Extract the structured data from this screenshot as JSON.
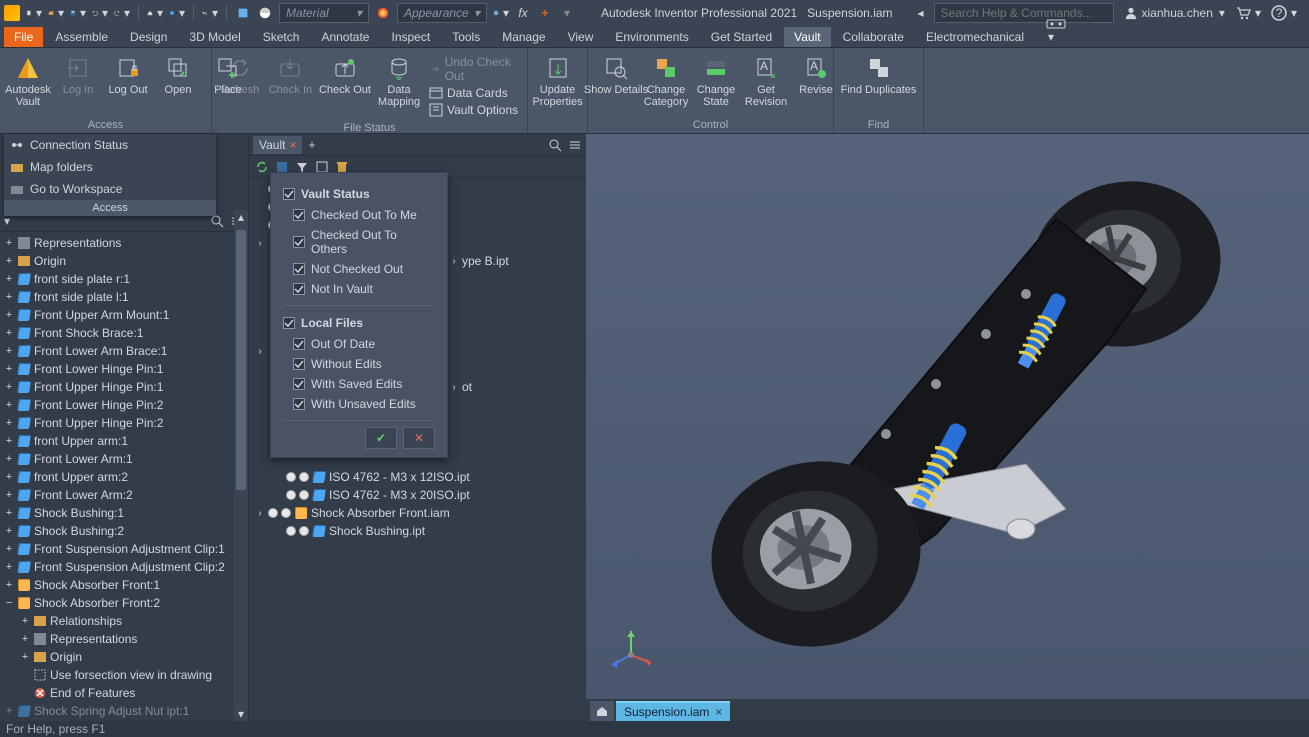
{
  "titlebar": {
    "material_placeholder": "Material",
    "appearance_placeholder": "Appearance",
    "app_title": "Autodesk Inventor Professional 2021",
    "document_name": "Suspension.iam",
    "search_placeholder": "Search Help & Commands...",
    "user_name": "xianhua.chen"
  },
  "ribbon_tabs": [
    "File",
    "Assemble",
    "Design",
    "3D Model",
    "Sketch",
    "Annotate",
    "Inspect",
    "Tools",
    "Manage",
    "View",
    "Environments",
    "Get Started",
    "Vault",
    "Collaborate",
    "Electromechanical"
  ],
  "ribbon_active": "Vault",
  "ribbon": {
    "access": {
      "autodesk_vault": "Autodesk\nVault",
      "log_in": "Log In",
      "log_out": "Log Out",
      "open": "Open",
      "place": "Place",
      "refresh": "Refresh",
      "label": "Access"
    },
    "file_status": {
      "check_in": "Check In",
      "check_out": "Check Out",
      "data_mapping": "Data\nMapping",
      "undo_check_out": "Undo Check Out",
      "data_cards": "Data Cards",
      "vault_options": "Vault Options",
      "update": "Update\nProperties",
      "label": "File Status"
    },
    "control": {
      "show_details": "Show Details",
      "change_category": "Change\nCategory",
      "change_state": "Change\nState",
      "get_revision": "Get\nRevision",
      "revise": "Revise",
      "label": "Control"
    },
    "find": {
      "find_duplicates": "Find Duplicates",
      "label": "Find"
    }
  },
  "access_popup": {
    "connection_status": "Connection Status",
    "map_folders": "Map folders",
    "go_to_workspace": "Go to Workspace",
    "label": "Access"
  },
  "model_tree": [
    {
      "depth": 0,
      "toggle": "+",
      "icon": "rep",
      "label": "Representations"
    },
    {
      "depth": 0,
      "toggle": "+",
      "icon": "folder",
      "label": "Origin"
    },
    {
      "depth": 0,
      "toggle": "+",
      "icon": "part",
      "label": "front side plate r:1"
    },
    {
      "depth": 0,
      "toggle": "+",
      "icon": "part",
      "label": "front side plate l:1"
    },
    {
      "depth": 0,
      "toggle": "+",
      "icon": "part",
      "label": "Front Upper Arm Mount:1"
    },
    {
      "depth": 0,
      "toggle": "+",
      "icon": "part",
      "label": "Front Shock Brace:1"
    },
    {
      "depth": 0,
      "toggle": "+",
      "icon": "part",
      "label": "Front Lower Arm Brace:1"
    },
    {
      "depth": 0,
      "toggle": "+",
      "icon": "part",
      "label": "Front Lower Hinge Pin:1"
    },
    {
      "depth": 0,
      "toggle": "+",
      "icon": "part",
      "label": "Front Upper Hinge Pin:1"
    },
    {
      "depth": 0,
      "toggle": "+",
      "icon": "part",
      "label": "Front Lower Hinge Pin:2"
    },
    {
      "depth": 0,
      "toggle": "+",
      "icon": "part",
      "label": "Front Upper Hinge Pin:2"
    },
    {
      "depth": 0,
      "toggle": "+",
      "icon": "part",
      "label": "front Upper arm:1"
    },
    {
      "depth": 0,
      "toggle": "+",
      "icon": "part",
      "label": "Front Lower Arm:1"
    },
    {
      "depth": 0,
      "toggle": "+",
      "icon": "part",
      "label": "front Upper arm:2"
    },
    {
      "depth": 0,
      "toggle": "+",
      "icon": "part",
      "label": "Front Lower Arm:2"
    },
    {
      "depth": 0,
      "toggle": "+",
      "icon": "part",
      "label": "Shock Bushing:1"
    },
    {
      "depth": 0,
      "toggle": "+",
      "icon": "part",
      "label": "Shock Bushing:2"
    },
    {
      "depth": 0,
      "toggle": "+",
      "icon": "part",
      "label": "Front Suspension Adjustment Clip:1"
    },
    {
      "depth": 0,
      "toggle": "+",
      "icon": "part",
      "label": "Front Suspension Adjustment Clip:2"
    },
    {
      "depth": 0,
      "toggle": "+",
      "icon": "asm",
      "label": "Shock Absorber Front:1"
    },
    {
      "depth": 0,
      "toggle": "−",
      "icon": "asm",
      "label": "Shock Absorber Front:2"
    },
    {
      "depth": 1,
      "toggle": "+",
      "icon": "folder",
      "label": "Relationships"
    },
    {
      "depth": 1,
      "toggle": "+",
      "icon": "rep",
      "label": "Representations"
    },
    {
      "depth": 1,
      "toggle": "+",
      "icon": "folder",
      "label": "Origin"
    },
    {
      "depth": 1,
      "toggle": "",
      "icon": "view",
      "label": "Use forsection view in drawing"
    },
    {
      "depth": 1,
      "toggle": "",
      "icon": "end",
      "label": "End of Features"
    },
    {
      "depth": 0,
      "toggle": "+",
      "icon": "part",
      "label": "Shock Spring Adjust Nut ipt:1",
      "cut": true
    }
  ],
  "vault_tab": "Vault",
  "vault_rows": [
    {
      "indent": 0,
      "chev": "",
      "dots": 1,
      "icon": "",
      "label": ""
    },
    {
      "indent": 0,
      "chev": "",
      "dots": 1,
      "icon": "",
      "label": ""
    },
    {
      "indent": 0,
      "chev": "",
      "dots": 1,
      "icon": "",
      "label": ""
    },
    {
      "indent": 0,
      "chev": "›",
      "dots": 0,
      "icon": "",
      "label": ""
    },
    {
      "indent": 0,
      "chev": "›",
      "dots": 0,
      "icon": "",
      "label": "ype B.ipt",
      "partial": true
    },
    {
      "indent": 0,
      "chev": "",
      "dots": 0,
      "icon": "",
      "label": ""
    },
    {
      "indent": 0,
      "chev": "",
      "dots": 0,
      "icon": "",
      "label": ""
    },
    {
      "indent": 0,
      "chev": "",
      "dots": 0,
      "icon": "",
      "label": ""
    },
    {
      "indent": 0,
      "chev": "",
      "dots": 0,
      "icon": "",
      "label": ""
    },
    {
      "indent": 0,
      "chev": "›",
      "dots": 0,
      "icon": "",
      "label": ""
    },
    {
      "indent": 0,
      "chev": "",
      "dots": 0,
      "icon": "",
      "label": ""
    },
    {
      "indent": 0,
      "chev": "›",
      "dots": 0,
      "icon": "",
      "label": "ot",
      "partial": true
    },
    {
      "indent": 0,
      "chev": "",
      "dots": 0,
      "icon": "",
      "label": ""
    },
    {
      "indent": 0,
      "chev": "",
      "dots": 0,
      "icon": "",
      "label": ""
    },
    {
      "indent": 0,
      "chev": "",
      "dots": 0,
      "icon": "",
      "label": ""
    },
    {
      "indent": 0,
      "chev": "",
      "dots": 0,
      "icon": "",
      "label": ""
    },
    {
      "indent": 1,
      "chev": "",
      "dots": 2,
      "icon": "part",
      "label": "ISO 4762 - M3 x 12ISO.ipt"
    },
    {
      "indent": 1,
      "chev": "",
      "dots": 2,
      "icon": "part",
      "label": "ISO 4762 - M3 x 20ISO.ipt"
    },
    {
      "indent": 0,
      "chev": "›",
      "dots": 2,
      "icon": "asm",
      "label": "Shock Absorber Front.iam"
    },
    {
      "indent": 1,
      "chev": "",
      "dots": 2,
      "icon": "part",
      "label": "Shock Bushing.ipt"
    }
  ],
  "filter": {
    "vault_status": "Vault Status",
    "checked_out_me": "Checked Out To Me",
    "checked_out_others": "Checked Out To Others",
    "not_checked_out": "Not Checked Out",
    "not_in_vault": "Not In Vault",
    "local_files": "Local Files",
    "out_of_date": "Out Of Date",
    "without_edits": "Without Edits",
    "with_saved": "With Saved Edits",
    "with_unsaved": "With Unsaved Edits"
  },
  "doc_tab": "Suspension.iam",
  "status": "For Help, press F1"
}
